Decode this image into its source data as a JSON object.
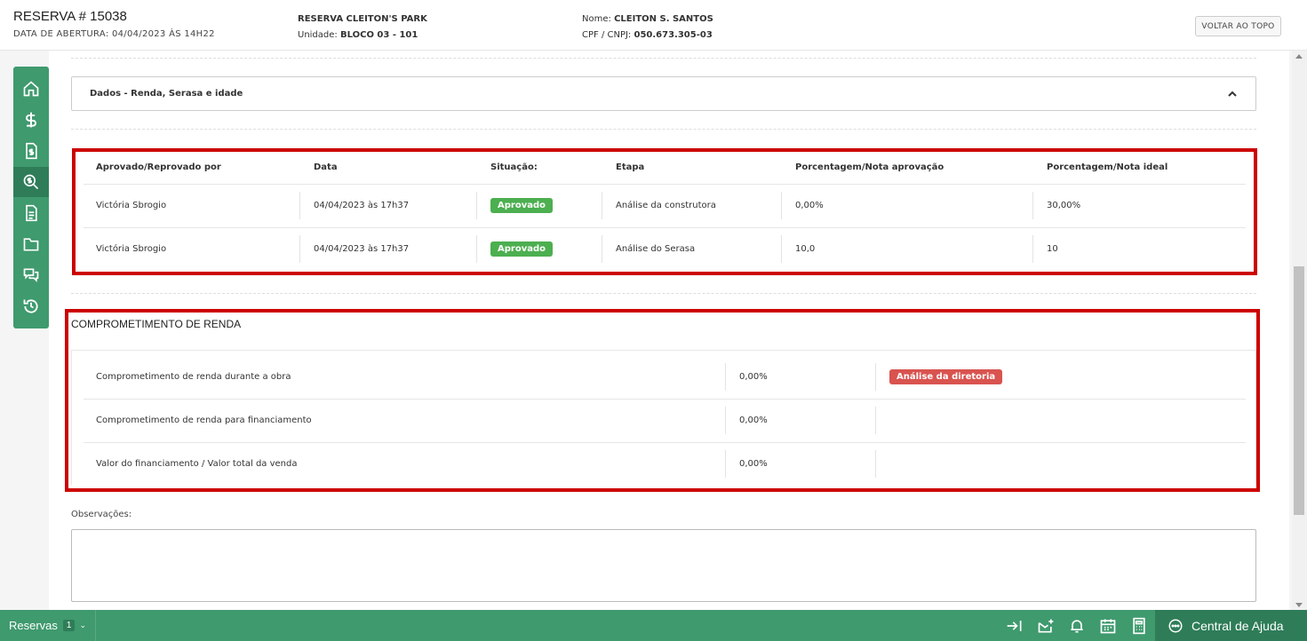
{
  "header": {
    "title": "RESERVA # 15038",
    "opened": "DATA DE ABERTURA: 04/04/2023 ÀS 14H22",
    "project": "RESERVA CLEITON'S PARK",
    "unit_label": "Unidade:",
    "unit_value": "BLOCO 03 - 101",
    "name_label": "Nome:",
    "name_value": "CLEITON S. SANTOS",
    "doc_label": "CPF / CNPJ:",
    "doc_value": "050.673.305-03",
    "back_top": "VOLTAR AO TOPO"
  },
  "sidebar": {
    "icons": [
      "home-icon",
      "dollar-icon",
      "invoice-icon",
      "search-money-icon",
      "document-icon",
      "folder-icon",
      "chat-icon",
      "history-icon"
    ]
  },
  "accordion": {
    "title": "Dados - Renda, Serasa e idade"
  },
  "approvals": {
    "headers": [
      "Aprovado/Reprovado por",
      "Data",
      "Situação:",
      "Etapa",
      "Porcentagem/Nota aprovação",
      "Porcentagem/Nota ideal"
    ],
    "rows": [
      {
        "by": "Victória Sbrogio",
        "date": "04/04/2023 às 17h37",
        "status": "Aprovado",
        "stage": "Análise da construtora",
        "score": "0,00%",
        "ideal": "30,00%"
      },
      {
        "by": "Victória Sbrogio",
        "date": "04/04/2023 às 17h37",
        "status": "Aprovado",
        "stage": "Análise do Serasa",
        "score": "10,0",
        "ideal": "10"
      }
    ],
    "colors": {
      "approved": "#4caf50"
    }
  },
  "income": {
    "title": "COMPROMETIMENTO DE RENDA",
    "rows": [
      {
        "label": "Comprometimento de renda durante a obra",
        "value": "0,00%",
        "badge": "Análise da diretoria"
      },
      {
        "label": "Comprometimento de renda para financiamento",
        "value": "0,00%",
        "badge": ""
      },
      {
        "label": "Valor do financiamento / Valor total da venda",
        "value": "0,00%",
        "badge": ""
      }
    ],
    "colors": {
      "badge": "#d9534f"
    }
  },
  "observations": {
    "label": "Observações:",
    "value": ""
  },
  "footer": {
    "reservas_label": "Reservas",
    "reservas_count": "1",
    "help_label": "Central de Ajuda",
    "icons": [
      "collapse-icon",
      "mail-alert-icon",
      "bell-icon",
      "calendar-icon",
      "calculator-icon"
    ]
  },
  "theme": {
    "accent": "#3f9a6e",
    "accent_dark": "#2e7d58",
    "highlight": "#cc0000"
  }
}
